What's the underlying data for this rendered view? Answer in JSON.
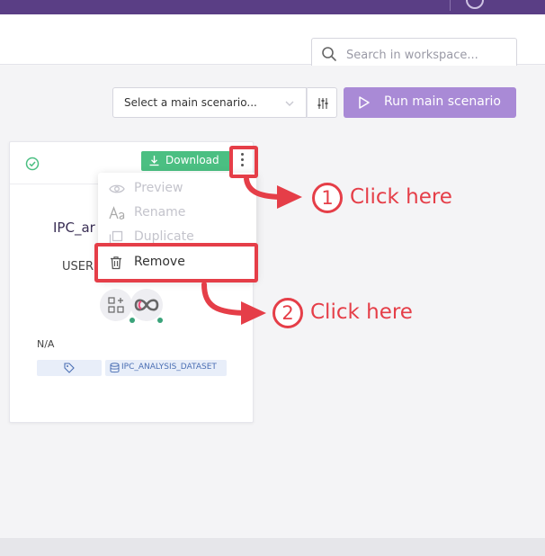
{
  "header": {
    "search_placeholder": "Search in workspace..."
  },
  "toolbar": {
    "scenario_select_value": "Select a main scenario...",
    "run_label": "Run main scenario"
  },
  "card": {
    "download_label": "Download",
    "title": "IPC_ar",
    "owner": "USER",
    "tag_value": "N/A",
    "dataset_label": "IPC_ANALYSIS_DATASET"
  },
  "context_menu": {
    "items": [
      {
        "label": "Preview",
        "icon": "eye-icon",
        "enabled": false
      },
      {
        "label": "Rename",
        "icon": "rename-icon",
        "enabled": false
      },
      {
        "label": "Duplicate",
        "icon": "duplicate-icon",
        "enabled": false
      },
      {
        "label": "Remove",
        "icon": "trash-icon",
        "enabled": true
      }
    ]
  },
  "annotations": [
    {
      "number": "1",
      "text": "Click here"
    },
    {
      "number": "2",
      "text": "Click here"
    }
  ],
  "colors": {
    "topbar": "#5a3e85",
    "run_button": "#a98ad6",
    "download_button": "#4bbf82",
    "annotation_red": "#e53e48",
    "dataset_chip_text": "#4b6fb4"
  }
}
